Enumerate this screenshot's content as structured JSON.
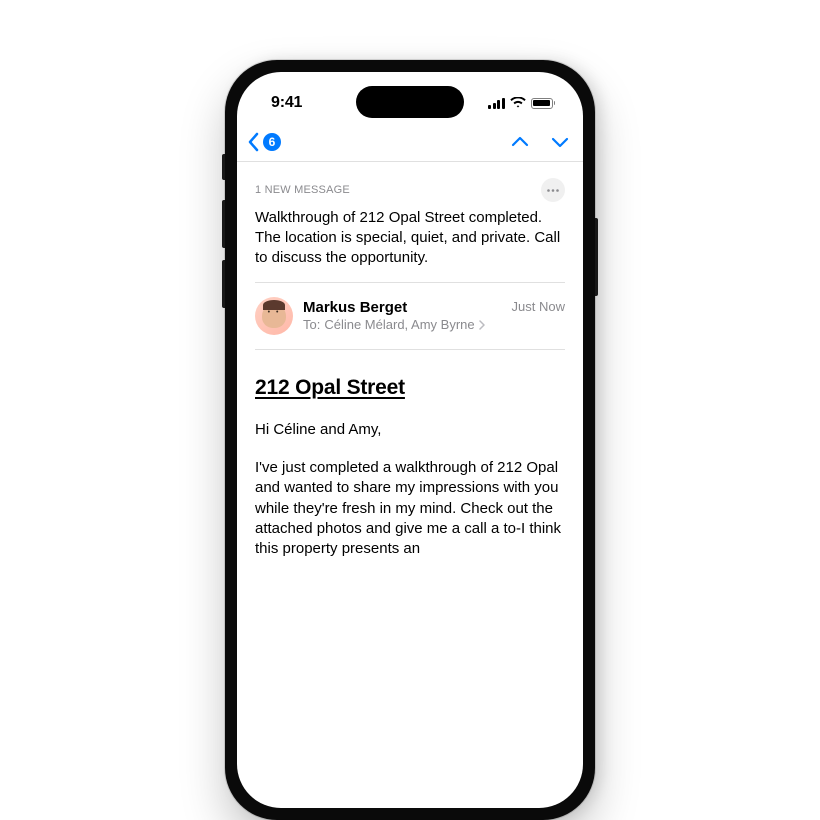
{
  "status_bar": {
    "time": "9:41"
  },
  "nav": {
    "unread_count": "6"
  },
  "summary": {
    "label": "1 NEW MESSAGE",
    "text": "Walkthrough of 212 Opal Street completed. The location is special, quiet, and private. Call to discuss the opportunity."
  },
  "sender": {
    "name": "Markus Berget",
    "to_label": "To:",
    "recipients": "Céline Mélard, Amy Byrne",
    "timestamp": "Just Now"
  },
  "email": {
    "subject": "212 Opal Street ",
    "greeting": "Hi Céline and Amy,",
    "body": "I've just completed a walkthrough of 212 Opal and wanted to share my impressions with you while they're fresh in my mind. Check out the attached photos and give me a call a to-I think this property presents an"
  }
}
